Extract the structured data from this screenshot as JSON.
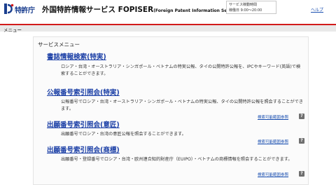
{
  "header": {
    "logo_text": "特許庁",
    "title_main": "外国特許情報サービス FOPISER",
    "title_sub": "(Foreign Patent Information Service)",
    "hours_label": "サービス稼動時間",
    "hours_value": "稼働日 9:00～20:00",
    "help_label": "ヘルプ"
  },
  "menu_bar": {
    "label": "メニュー"
  },
  "service_menu": {
    "title": "サービスメニュー",
    "items": [
      {
        "title": "書誌情報検索(特実)",
        "description": "ロシア・台湾・オーストラリア・シンガポール・ベトナムの特実公報、タイの公開特許公報を、IPCやキーワード(英語)で検索することができます。",
        "link": "",
        "icon": ""
      },
      {
        "title": "公報番号索引照会(特実)",
        "description": "公報番号でロシア・台湾・オーストラリア・シンガポール・ベトナムの特実公報、タイの公開特許公報を照会することができます。",
        "link": "検索可能範囲参照",
        "icon": "?"
      },
      {
        "title": "出願番号索引照会(意匠)",
        "description": "出願番号でロシア・台湾の意匠公報を照会することができます。",
        "link": "検索可能範囲参照",
        "icon": "?"
      },
      {
        "title": "出願番号索引照会(商標)",
        "description": "出願番号・登録番号でロシア・台湾・欧州連合知的財産庁（EUIPO）・ベトナムの商標情報を照会することができます。",
        "link": "検索可能範囲参照",
        "icon": "?"
      }
    ]
  }
}
